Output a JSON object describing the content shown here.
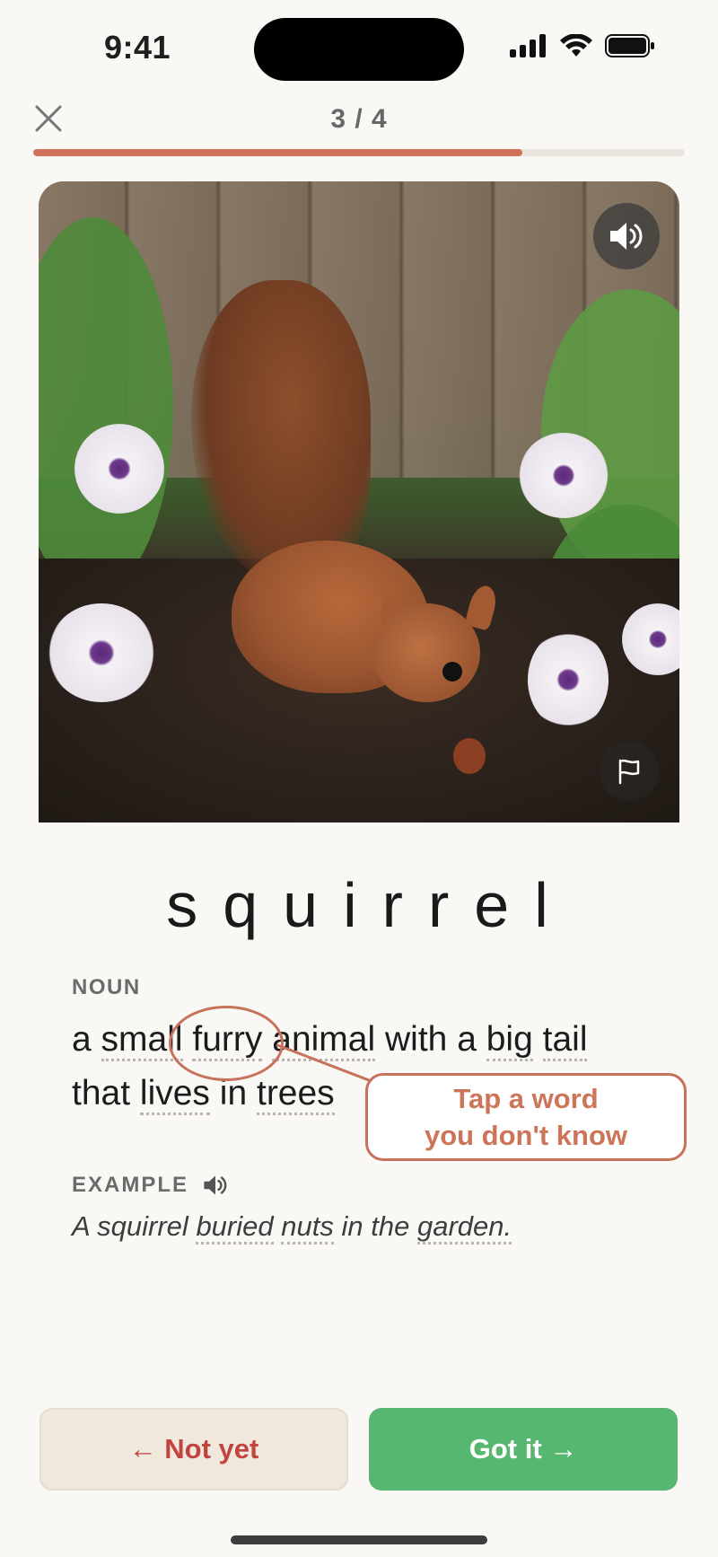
{
  "status_bar": {
    "time": "9:41"
  },
  "progress": {
    "label": "3 / 4",
    "fraction": 0.75
  },
  "card": {
    "word": "squirrel",
    "part_of_speech": "NOUN",
    "definition_words": [
      "a",
      "small",
      "furry",
      "animal",
      "with",
      "a",
      "big",
      "tail",
      "that",
      "lives",
      "in",
      "trees"
    ],
    "tooltip_line1": "Tap a word",
    "tooltip_line2": "you don't know",
    "example_label": "EXAMPLE",
    "example_words": [
      "A",
      "squirrel",
      "buried",
      "nuts",
      "in",
      "the",
      "garden."
    ]
  },
  "buttons": {
    "not_yet": "← Not yet",
    "got_it": "Got it →"
  },
  "colors": {
    "accent": "#d0735a",
    "success": "#57b66f",
    "danger_text": "#c2443f",
    "background": "#f9f8f5"
  },
  "icons": [
    "close-icon",
    "speaker-icon",
    "flag-icon",
    "signal-icon",
    "wifi-icon",
    "battery-icon"
  ]
}
